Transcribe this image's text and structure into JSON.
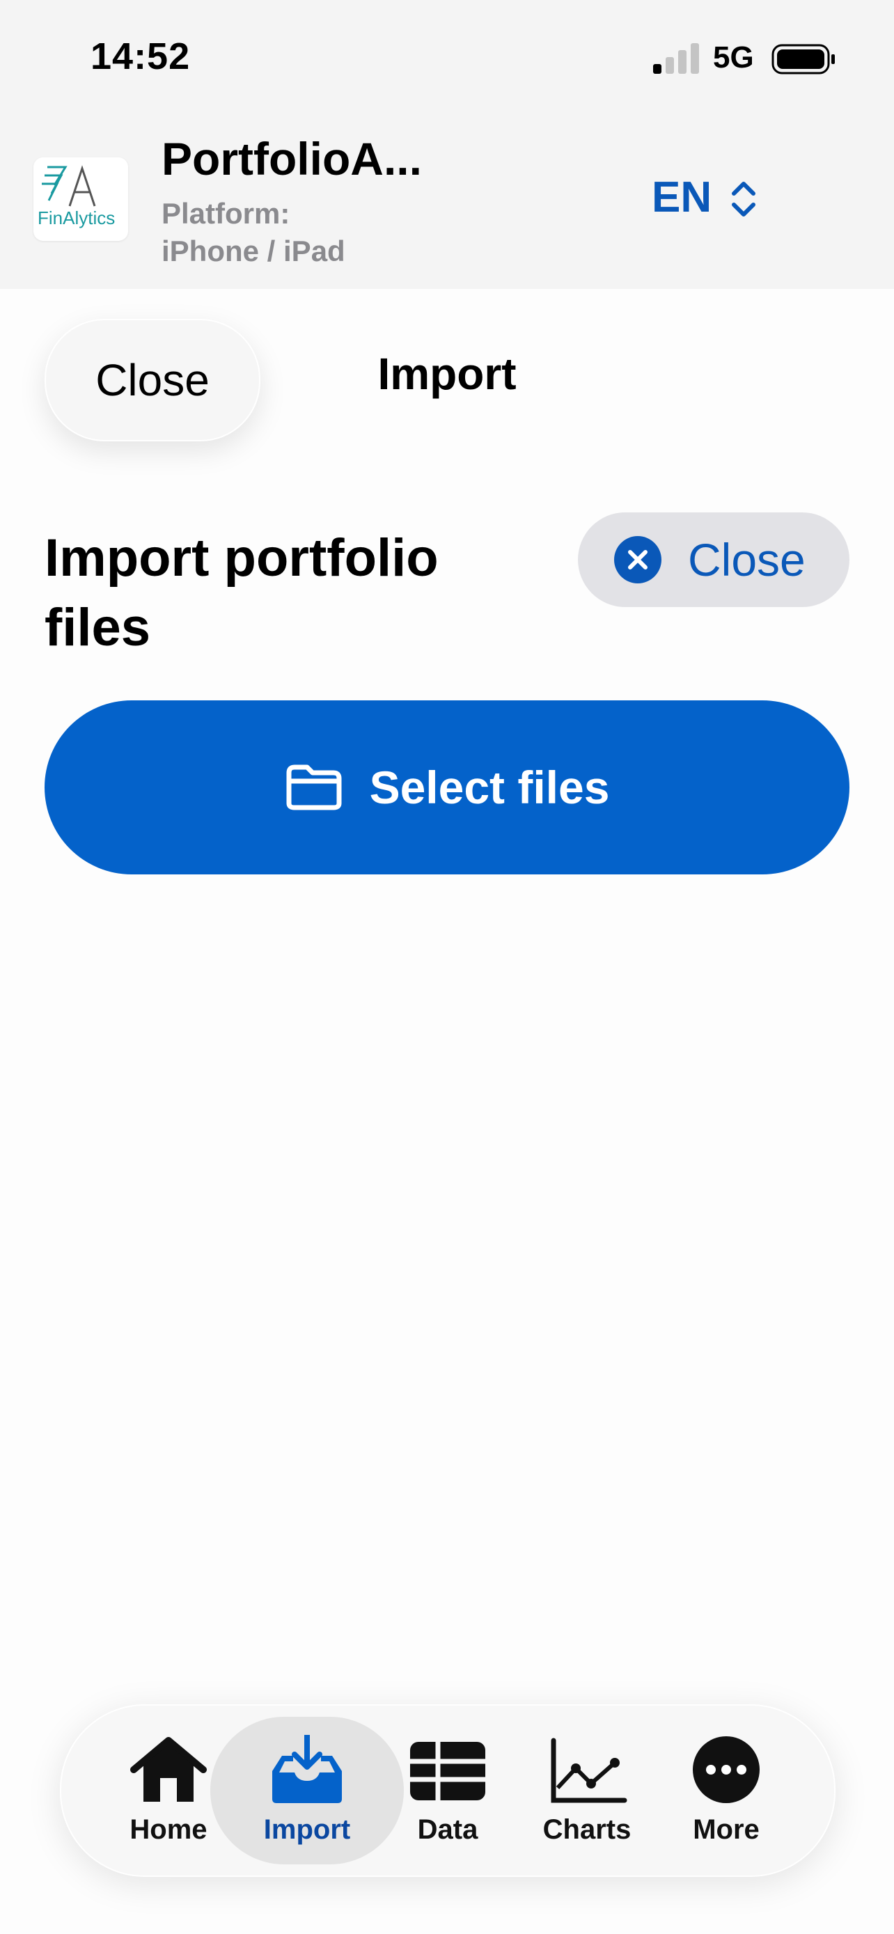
{
  "status_bar": {
    "time": "14:52",
    "network": "5G",
    "signal_bars_filled": 1,
    "signal_bars_total": 4
  },
  "header": {
    "logo_text": "FinAlytics",
    "app_title": "PortfolioA...",
    "platform_line1": "Platform:",
    "platform_line2": "iPhone / iPad",
    "language": "EN"
  },
  "nav": {
    "close_label": "Close",
    "title": "Import"
  },
  "content": {
    "heading": "Import portfolio files",
    "close_button_label": "Close",
    "select_files_label": "Select files"
  },
  "tabbar": {
    "items": [
      {
        "label": "Home",
        "icon": "house-icon"
      },
      {
        "label": "Import",
        "icon": "tray-download-icon",
        "active": true
      },
      {
        "label": "Data",
        "icon": "table-grid-icon"
      },
      {
        "label": "Charts",
        "icon": "line-chart-icon"
      },
      {
        "label": "More",
        "icon": "ellipsis-circle-icon"
      }
    ]
  },
  "colors": {
    "accent": "#0462ca",
    "accent_text": "#0a58b8",
    "header_bg": "#f4f4f4",
    "logo_teal": "#1a9aa0"
  }
}
